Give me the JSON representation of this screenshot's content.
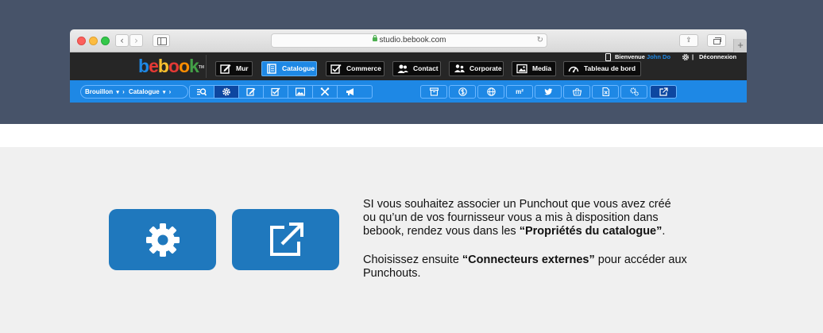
{
  "browser": {
    "url": "studio.bebook.com"
  },
  "app": {
    "logo_text": "bebook",
    "logo_tm": "TM",
    "welcome_label": "Bienvenue",
    "user_name": "John Do",
    "separator": "|",
    "logout_label": "Déconnexion",
    "nav": [
      {
        "label": "Mur",
        "icon": "edit-icon"
      },
      {
        "label": "Catalogue",
        "icon": "book-icon",
        "active": true
      },
      {
        "label": "Commerce",
        "icon": "checklist-icon"
      },
      {
        "label": "Contact",
        "icon": "users-icon"
      },
      {
        "label": "Corporate",
        "icon": "handshake-icon"
      },
      {
        "label": "Media",
        "icon": "image-icon"
      },
      {
        "label": "Tableau de bord",
        "icon": "gauge-icon"
      }
    ]
  },
  "toolbar": {
    "breadcrumb_1": "Brouillon",
    "breadcrumb_2": "Catalogue",
    "tools_left": [
      "binoculars-icon",
      "gear-icon",
      "edit-icon",
      "edit-check-icon",
      "image-icon",
      "tools-icon",
      "megaphone-icon"
    ],
    "tools_right": [
      "archive-icon",
      "currency-icon",
      "globe-icon",
      "area-m2-icon",
      "twitter-icon",
      "basket-icon",
      "file-icon",
      "settings-link-icon",
      "external-link-icon"
    ],
    "area_label": "m²"
  },
  "big_buttons": [
    {
      "icon": "gear-icon"
    },
    {
      "icon": "external-link-icon"
    }
  ],
  "instructions": {
    "para1_line1": "SI vous souhaitez associer un Punchout que vous  avez créé",
    "para1_line2": "ou qu’un de vos fournisseur vous a mis à disposition dans",
    "para1_line3_pre": "bebook, rendez vous dans les ",
    "para1_line3_bold": "“Propriétés du catalogue”",
    "para1_line3_post": ".",
    "para2_pre": "Choisissez ensuite ",
    "para2_bold": "“Connecteurs externes”",
    "para2_post": " pour accéder aux",
    "para2_line2": "Punchouts."
  },
  "colors": {
    "banner_bg": "#475369",
    "app_header_bg": "#262626",
    "toolbar_bg": "#1e88e5",
    "big_button_bg": "#1f78bd",
    "page_bg": "#f0f0f0"
  }
}
